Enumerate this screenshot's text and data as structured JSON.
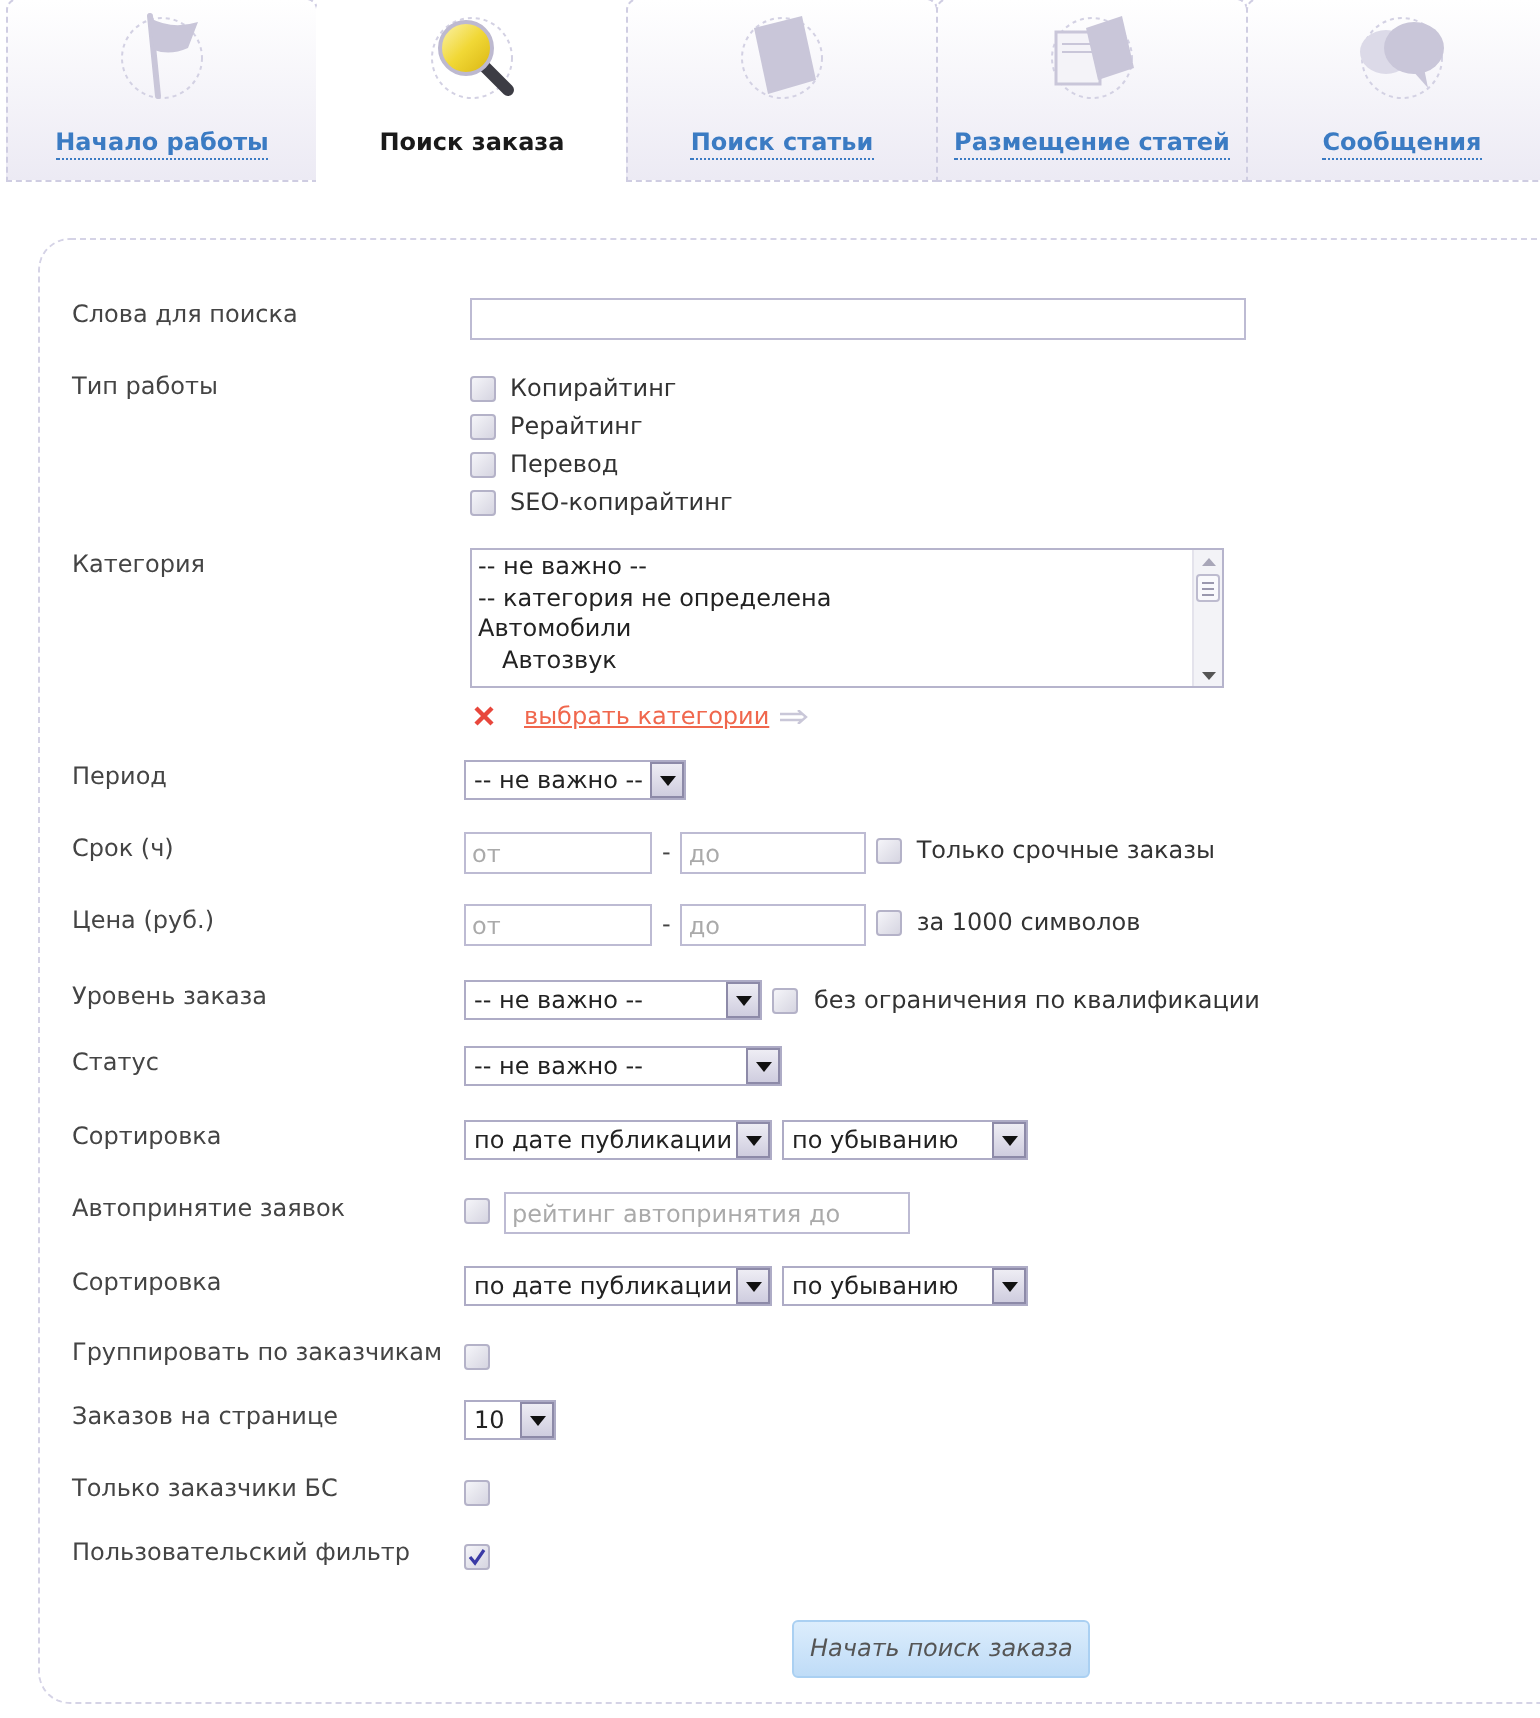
{
  "tabs": [
    {
      "label": "Начало работы",
      "selected": false
    },
    {
      "label": "Поиск заказа",
      "selected": true
    },
    {
      "label": "Поиск статьи",
      "selected": false
    },
    {
      "label": "Размещение статей",
      "selected": false
    },
    {
      "label": "Сообщения",
      "selected": false
    }
  ],
  "form": {
    "rows": [
      {
        "kind": "text",
        "label": "Слова для поиска"
      },
      {
        "kind": "checklist",
        "label": "Тип работы",
        "options": [
          {
            "label": "Копирайтинг",
            "checked": false
          },
          {
            "label": "Рерайтинг",
            "checked": false
          },
          {
            "label": "Перевод",
            "checked": false
          },
          {
            "label": "SEO-копирайтинг",
            "checked": false
          }
        ]
      },
      {
        "kind": "listbox",
        "label": "Категория",
        "items": [
          {
            "text": "-- не важно --"
          },
          {
            "text": "-- категория не определена"
          },
          {
            "text": "Автомобили",
            "children": [
              {
                "text": "Автозвук"
              }
            ]
          }
        ],
        "link": "выбрать категории"
      },
      {
        "kind": "select",
        "label": "Период",
        "value": "-- не важно --"
      },
      {
        "kind": "range",
        "label": "Срок (ч)",
        "from_placeholder": "от",
        "separator": "-",
        "to_placeholder": "до",
        "option": {
          "label": "Только срочные заказы",
          "checked": false
        }
      },
      {
        "kind": "range",
        "label": "Цена (руб.)",
        "from_placeholder": "от",
        "separator": "-",
        "to_placeholder": "до",
        "option": {
          "label": "за 1000 символов",
          "checked": false
        }
      },
      {
        "kind": "select",
        "label": "Уровень заказа",
        "value": "-- не важно --",
        "option": {
          "label": "без ограничения по квалификации",
          "checked": false
        }
      },
      {
        "kind": "select",
        "label": "Статус",
        "value": "-- не важно --"
      },
      {
        "kind": "select_pair",
        "label": "Сортировка",
        "values": [
          "по дате публикации",
          "по убыванию"
        ]
      },
      {
        "kind": "checkbox_input",
        "label": "Автопринятие заявок",
        "checked": false,
        "placeholder": "рейтинг автопринятия до"
      },
      {
        "kind": "select_pair",
        "label": "Сортировка",
        "values": [
          "по дате публикации",
          "по убыванию"
        ]
      },
      {
        "kind": "checkbox",
        "label": "Группировать по заказчикам",
        "checked": false
      },
      {
        "kind": "select",
        "label": "Заказов на странице",
        "value": "10"
      },
      {
        "kind": "checkbox",
        "label": "Только заказчики БС",
        "checked": false
      },
      {
        "kind": "checkbox",
        "label": "Пользовательский фильтр",
        "checked": true
      }
    ],
    "submit": "Начать поиск заказа"
  }
}
